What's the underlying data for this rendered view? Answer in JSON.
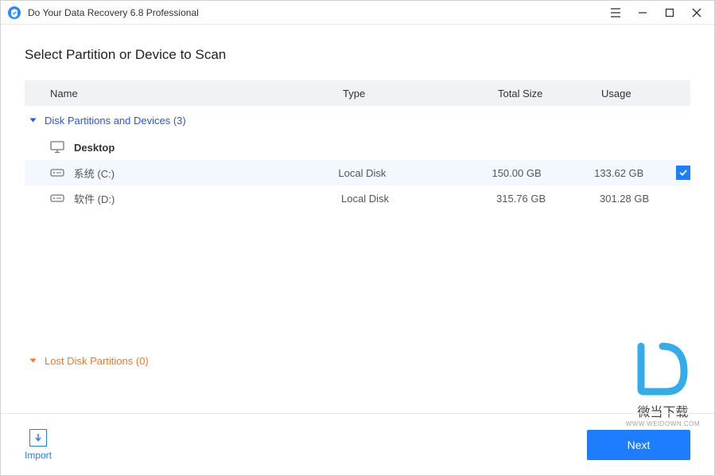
{
  "window": {
    "title": "Do Your Data Recovery 6.8 Professional"
  },
  "heading": "Select Partition or Device to Scan",
  "columns": {
    "name": "Name",
    "type": "Type",
    "size": "Total Size",
    "usage": "Usage"
  },
  "groups": {
    "partitions": {
      "title": "Disk Partitions and Devices (3)",
      "items": [
        {
          "name": "Desktop",
          "type": "",
          "size": "",
          "usage": "",
          "selected": false,
          "kind": "desktop"
        },
        {
          "name": "系统 (C:)",
          "type": "Local Disk",
          "size": "150.00 GB",
          "usage": "133.62 GB",
          "selected": true,
          "kind": "disk"
        },
        {
          "name": "软件 (D:)",
          "type": "Local Disk",
          "size": "315.76 GB",
          "usage": "301.28 GB",
          "selected": false,
          "kind": "disk"
        }
      ]
    },
    "lost": {
      "title": "Lost Disk Partitions (0)"
    }
  },
  "footer": {
    "import": "Import",
    "next": "Next"
  },
  "watermark": {
    "text": "微当下载",
    "sub": "WWW.WEIDOWN.COM"
  }
}
